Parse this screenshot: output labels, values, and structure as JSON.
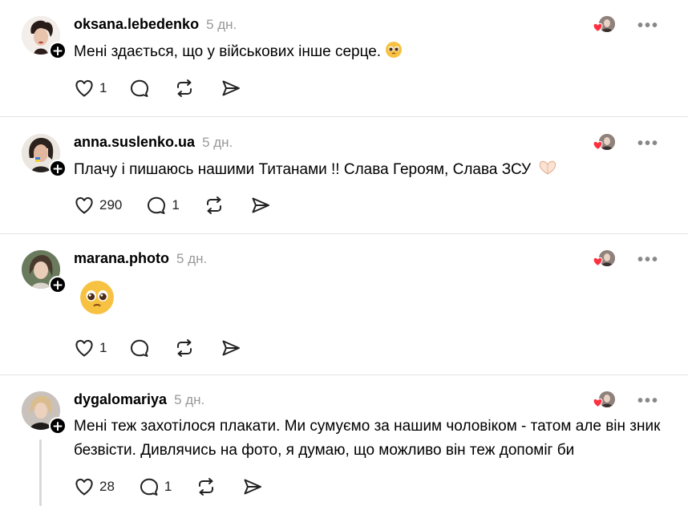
{
  "posts": [
    {
      "username": "oksana.lebedenko",
      "time": "5 дн.",
      "text": "Мені здається, що у військових інше серце.",
      "likes": "1",
      "replies": ""
    },
    {
      "username": "anna.suslenko.ua",
      "time": "5 дн.",
      "text": "Плачу і пишаюсь нашими Титанами !! Слава Героям, Слава ЗСУ",
      "likes": "290",
      "replies": "1"
    },
    {
      "username": "marana.photo",
      "time": "5 дн.",
      "text": "",
      "likes": "1",
      "replies": ""
    },
    {
      "username": "dygalomariya",
      "time": "5 дн.",
      "text": "Мені теж захотілося плакати. Ми сумуємо за нашим чоловіком - татом але він зник безвісти. Дивлячись на фото, я думаю, що можливо він теж допоміг би",
      "likes": "28",
      "replies": "1"
    }
  ],
  "icons": {
    "like": "heart-outline-icon",
    "reply": "speech-bubble-icon",
    "repost": "repost-icon",
    "share": "send-icon",
    "liked_by_author": "liked-by-author-icon",
    "more": "more-dots-icon",
    "follow": "plus-icon"
  },
  "colors": {
    "heart_red": "#ff3040",
    "meta_grey": "#999999",
    "divider": "#e4e4e4"
  }
}
